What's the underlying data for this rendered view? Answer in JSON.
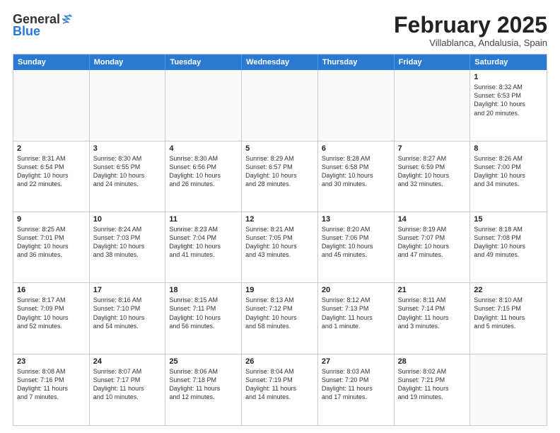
{
  "logo": {
    "general": "General",
    "blue": "Blue"
  },
  "header": {
    "month": "February 2025",
    "location": "Villablanca, Andalusia, Spain"
  },
  "weekdays": [
    "Sunday",
    "Monday",
    "Tuesday",
    "Wednesday",
    "Thursday",
    "Friday",
    "Saturday"
  ],
  "weeks": [
    [
      {
        "day": "",
        "info": ""
      },
      {
        "day": "",
        "info": ""
      },
      {
        "day": "",
        "info": ""
      },
      {
        "day": "",
        "info": ""
      },
      {
        "day": "",
        "info": ""
      },
      {
        "day": "",
        "info": ""
      },
      {
        "day": "1",
        "info": "Sunrise: 8:32 AM\nSunset: 6:53 PM\nDaylight: 10 hours\nand 20 minutes."
      }
    ],
    [
      {
        "day": "2",
        "info": "Sunrise: 8:31 AM\nSunset: 6:54 PM\nDaylight: 10 hours\nand 22 minutes."
      },
      {
        "day": "3",
        "info": "Sunrise: 8:30 AM\nSunset: 6:55 PM\nDaylight: 10 hours\nand 24 minutes."
      },
      {
        "day": "4",
        "info": "Sunrise: 8:30 AM\nSunset: 6:56 PM\nDaylight: 10 hours\nand 26 minutes."
      },
      {
        "day": "5",
        "info": "Sunrise: 8:29 AM\nSunset: 6:57 PM\nDaylight: 10 hours\nand 28 minutes."
      },
      {
        "day": "6",
        "info": "Sunrise: 8:28 AM\nSunset: 6:58 PM\nDaylight: 10 hours\nand 30 minutes."
      },
      {
        "day": "7",
        "info": "Sunrise: 8:27 AM\nSunset: 6:59 PM\nDaylight: 10 hours\nand 32 minutes."
      },
      {
        "day": "8",
        "info": "Sunrise: 8:26 AM\nSunset: 7:00 PM\nDaylight: 10 hours\nand 34 minutes."
      }
    ],
    [
      {
        "day": "9",
        "info": "Sunrise: 8:25 AM\nSunset: 7:01 PM\nDaylight: 10 hours\nand 36 minutes."
      },
      {
        "day": "10",
        "info": "Sunrise: 8:24 AM\nSunset: 7:03 PM\nDaylight: 10 hours\nand 38 minutes."
      },
      {
        "day": "11",
        "info": "Sunrise: 8:23 AM\nSunset: 7:04 PM\nDaylight: 10 hours\nand 41 minutes."
      },
      {
        "day": "12",
        "info": "Sunrise: 8:21 AM\nSunset: 7:05 PM\nDaylight: 10 hours\nand 43 minutes."
      },
      {
        "day": "13",
        "info": "Sunrise: 8:20 AM\nSunset: 7:06 PM\nDaylight: 10 hours\nand 45 minutes."
      },
      {
        "day": "14",
        "info": "Sunrise: 8:19 AM\nSunset: 7:07 PM\nDaylight: 10 hours\nand 47 minutes."
      },
      {
        "day": "15",
        "info": "Sunrise: 8:18 AM\nSunset: 7:08 PM\nDaylight: 10 hours\nand 49 minutes."
      }
    ],
    [
      {
        "day": "16",
        "info": "Sunrise: 8:17 AM\nSunset: 7:09 PM\nDaylight: 10 hours\nand 52 minutes."
      },
      {
        "day": "17",
        "info": "Sunrise: 8:16 AM\nSunset: 7:10 PM\nDaylight: 10 hours\nand 54 minutes."
      },
      {
        "day": "18",
        "info": "Sunrise: 8:15 AM\nSunset: 7:11 PM\nDaylight: 10 hours\nand 56 minutes."
      },
      {
        "day": "19",
        "info": "Sunrise: 8:13 AM\nSunset: 7:12 PM\nDaylight: 10 hours\nand 58 minutes."
      },
      {
        "day": "20",
        "info": "Sunrise: 8:12 AM\nSunset: 7:13 PM\nDaylight: 11 hours\nand 1 minute."
      },
      {
        "day": "21",
        "info": "Sunrise: 8:11 AM\nSunset: 7:14 PM\nDaylight: 11 hours\nand 3 minutes."
      },
      {
        "day": "22",
        "info": "Sunrise: 8:10 AM\nSunset: 7:15 PM\nDaylight: 11 hours\nand 5 minutes."
      }
    ],
    [
      {
        "day": "23",
        "info": "Sunrise: 8:08 AM\nSunset: 7:16 PM\nDaylight: 11 hours\nand 7 minutes."
      },
      {
        "day": "24",
        "info": "Sunrise: 8:07 AM\nSunset: 7:17 PM\nDaylight: 11 hours\nand 10 minutes."
      },
      {
        "day": "25",
        "info": "Sunrise: 8:06 AM\nSunset: 7:18 PM\nDaylight: 11 hours\nand 12 minutes."
      },
      {
        "day": "26",
        "info": "Sunrise: 8:04 AM\nSunset: 7:19 PM\nDaylight: 11 hours\nand 14 minutes."
      },
      {
        "day": "27",
        "info": "Sunrise: 8:03 AM\nSunset: 7:20 PM\nDaylight: 11 hours\nand 17 minutes."
      },
      {
        "day": "28",
        "info": "Sunrise: 8:02 AM\nSunset: 7:21 PM\nDaylight: 11 hours\nand 19 minutes."
      },
      {
        "day": "",
        "info": ""
      }
    ]
  ]
}
